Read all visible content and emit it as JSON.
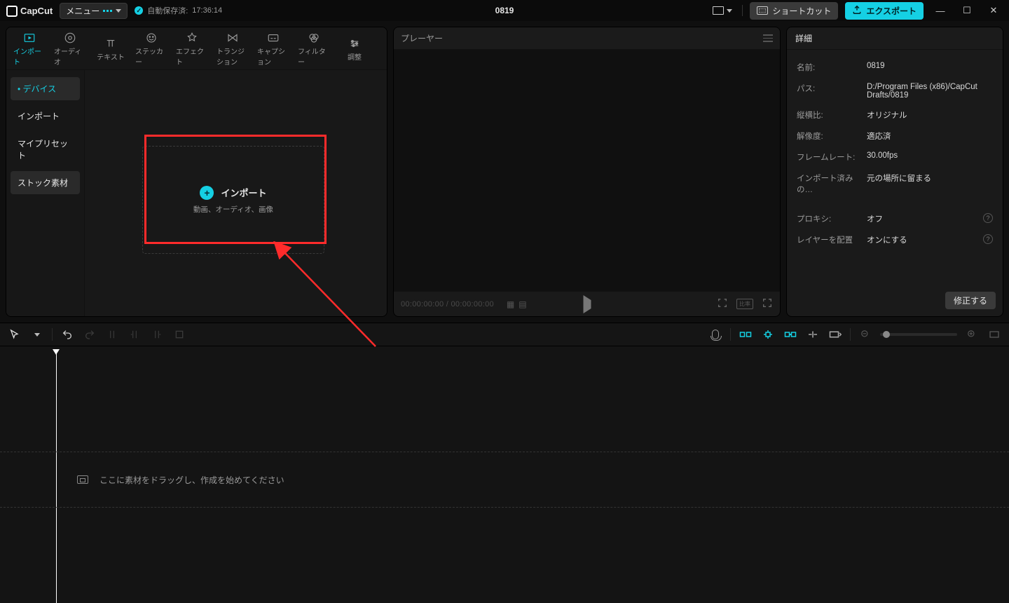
{
  "topbar": {
    "app_name": "CapCut",
    "menu_label": "メニュー",
    "autosave_label": "自動保存済:",
    "autosave_time": "17:36:14",
    "project_title": "0819",
    "shortcut_label": "ショートカット",
    "export_label": "エクスポート"
  },
  "tabs": [
    {
      "id": "import",
      "label": "インポート"
    },
    {
      "id": "audio",
      "label": "オーディオ"
    },
    {
      "id": "text",
      "label": "テキスト"
    },
    {
      "id": "sticker",
      "label": "ステッカー"
    },
    {
      "id": "effect",
      "label": "エフェクト"
    },
    {
      "id": "transition",
      "label": "トランジション"
    },
    {
      "id": "caption",
      "label": "キャプション"
    },
    {
      "id": "filter",
      "label": "フィルター"
    },
    {
      "id": "adjust",
      "label": "調整"
    }
  ],
  "side_tabs": {
    "device": "デバイス",
    "import": "インポート",
    "mypreset": "マイプリセット",
    "stock": "ストック素材"
  },
  "side_active_marker": "•",
  "import_box": {
    "title": "インポート",
    "sub": "動画、オーディオ、画像"
  },
  "player": {
    "title": "プレーヤー",
    "time_current": "00:00:00:00",
    "time_sep": " / ",
    "time_total": "00:00:00:00"
  },
  "details": {
    "title": "詳細",
    "rows": {
      "name_k": "名前:",
      "name_v": "0819",
      "path_k": "パス:",
      "path_v": "D:/Program Files (x86)/CapCut Drafts/0819",
      "aspect_k": "縦横比:",
      "aspect_v": "オリジナル",
      "res_k": "解像度:",
      "res_v": "適応済",
      "fps_k": "フレームレート:",
      "fps_v": "30.00fps",
      "importedKeep_k": "インポート済みの…",
      "importedKeep_v": "元の場所に留まる",
      "proxy_k": "プロキシ:",
      "proxy_v": "オフ",
      "layer_k": "レイヤーを配置",
      "layer_v": "オンにする"
    },
    "fix_btn": "修正する"
  },
  "timeline": {
    "drop_hint": "ここに素材をドラッグし、作成を始めてください"
  }
}
